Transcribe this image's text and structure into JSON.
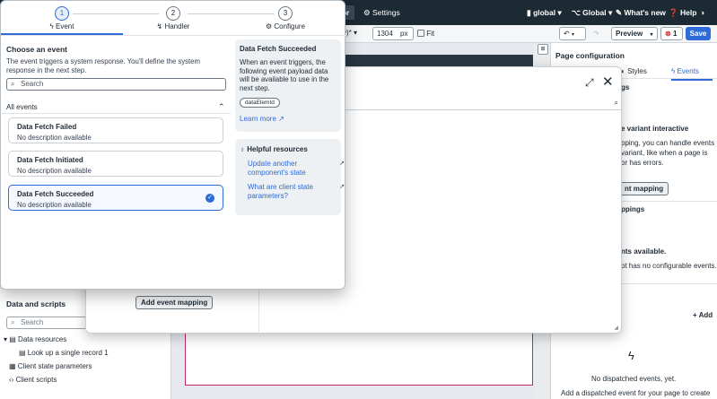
{
  "topbar": {
    "active_tab": "tor",
    "settings_label": "Settings",
    "scope_label": "global",
    "app_scope_label": "Global",
    "whats_new_label": "What's new",
    "help_label": "Help"
  },
  "toolbar": {
    "viewport_label": "y)*",
    "width_value": "1304",
    "width_unit": "px",
    "fit_label": "Fit",
    "preview_label": "Preview",
    "error_count": "1",
    "save_label": "Save"
  },
  "right_panel": {
    "title": "Page configuration",
    "tab_styles": "Styles",
    "tab_events": "Events",
    "gs_fragment": "gs",
    "variant_heading": "e variant interactive",
    "variant_desc": "pping, you can handle events variant, like when a page is or has errors.",
    "mapping_button": "nt mapping",
    "mappings_fragment": "ppings",
    "no_events_heading": "nts available.",
    "no_events_desc": "ot has no configurable events.",
    "add_label": "+ Add",
    "no_dispatched": "No dispatched events, yet.",
    "add_dispatched": "Add a dispatched event for your page to create"
  },
  "left_panel": {
    "title": "Data and scripts",
    "search_placeholder": "Search",
    "data_resources_label": "Data resources",
    "lookup_label": "Look up a single record 1",
    "client_state_label": "Client state parameters",
    "client_scripts_label": "Client scripts"
  },
  "dialog": {
    "add_mapping_label": "Add event mapping"
  },
  "popover": {
    "steps": [
      {
        "num": "1",
        "label": "Event"
      },
      {
        "num": "2",
        "label": "Handler"
      },
      {
        "num": "3",
        "label": "Configure"
      }
    ],
    "choose_title": "Choose an event",
    "choose_desc": "The event triggers a system response. You'll define the system response in the next step.",
    "search_placeholder": "Search",
    "all_events_label": "All events",
    "events": [
      {
        "name": "Data Fetch Failed",
        "desc": "No description available"
      },
      {
        "name": "Data Fetch Initiated",
        "desc": "No description available"
      },
      {
        "name": "Data Fetch Succeeded",
        "desc": "No description available"
      }
    ],
    "info": {
      "title": "Data Fetch Succeeded",
      "text": "When an event triggers, the following event payload data will be available to use in the next step.",
      "chip": "dataElemId",
      "learn_more": "Learn more"
    },
    "help": {
      "title": "Helpful resources",
      "link1": "Update another component's state",
      "link2": "What are client state parameters?"
    }
  },
  "colors": {
    "accent": "#2e6ad8",
    "header_bg": "#1b2a33",
    "canvas_border": "#c2276b",
    "error": "#d32f2f"
  }
}
